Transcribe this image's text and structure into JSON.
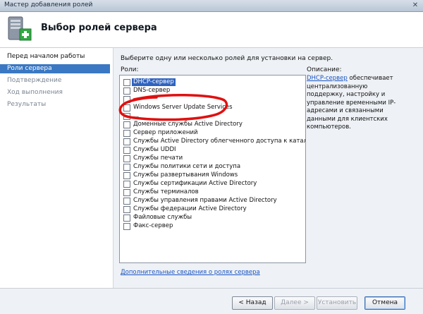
{
  "window": {
    "title": "Мастер добавления ролей",
    "close_glyph": "✕"
  },
  "header": {
    "title": "Выбор ролей сервера",
    "icon": "server-add-icon"
  },
  "nav": {
    "items": [
      {
        "label": "Перед началом работы",
        "state": "done"
      },
      {
        "label": "Роли сервера",
        "state": "active"
      },
      {
        "label": "Подтверждение",
        "state": "pending"
      },
      {
        "label": "Ход выполнения",
        "state": "pending"
      },
      {
        "label": "Результаты",
        "state": "pending"
      }
    ]
  },
  "content": {
    "instruction": "Выберите одну или несколько ролей для установки на сервер.",
    "roles_label": "Роли:",
    "roles": [
      {
        "label": "DHCP-сервер",
        "checked": false,
        "selected": true
      },
      {
        "label": "DNS-сервер",
        "checked": false
      },
      {
        "label": "...",
        "checked": false
      },
      {
        "label": "Windows Server Update Services",
        "checked": false
      },
      {
        "label": "...",
        "checked": false
      },
      {
        "label": "Доменные службы Active Directory",
        "checked": false
      },
      {
        "label": "Сервер приложений",
        "checked": false
      },
      {
        "label": "Службы Active Directory облегченного доступа к каталогам",
        "checked": false
      },
      {
        "label": "Службы UDDI",
        "checked": false
      },
      {
        "label": "Службы печати",
        "checked": false
      },
      {
        "label": "Службы политики сети и доступа",
        "checked": false
      },
      {
        "label": "Службы развертывания Windows",
        "checked": false
      },
      {
        "label": "Службы сертификации Active Directory",
        "checked": false
      },
      {
        "label": "Службы терминалов",
        "checked": false
      },
      {
        "label": "Службы управления правами Active Directory",
        "checked": false
      },
      {
        "label": "Службы федерации Active Directory",
        "checked": false
      },
      {
        "label": "Файловые службы",
        "checked": false
      },
      {
        "label": "Факс-сервер",
        "checked": false
      }
    ],
    "description_label": "Описание:",
    "description_link": "DHCP-сервер",
    "description_text": " обеспечивает централизованную поддержку, настройку и управление временными IP-адресами и связанными данными для клиентских компьютеров.",
    "more_info_link": "Дополнительные сведения о ролях сервера"
  },
  "buttons": {
    "back": "< Назад",
    "next": "Далее >",
    "install": "Установить",
    "cancel": "Отмена"
  },
  "colors": {
    "accent": "#3a78c3",
    "highlight": "#2f63c0",
    "annotation": "#e01010"
  }
}
